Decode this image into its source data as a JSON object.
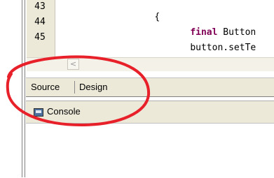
{
  "editor": {
    "line_numbers": [
      "43",
      "44",
      "45"
    ],
    "code_lines": [
      {
        "keyword": "",
        "text": "{"
      },
      {
        "keyword": "final",
        "text": " Button"
      },
      {
        "keyword": "",
        "text": "button.setTe"
      }
    ]
  },
  "scrollbar": {
    "left_arrow": "<"
  },
  "tabs": {
    "source": "Source",
    "design": "Design"
  },
  "console": {
    "label": "Console"
  },
  "colors": {
    "keyword": "#7f0055",
    "annotation": "#e8202a",
    "panel_bg": "#ece9d8"
  }
}
